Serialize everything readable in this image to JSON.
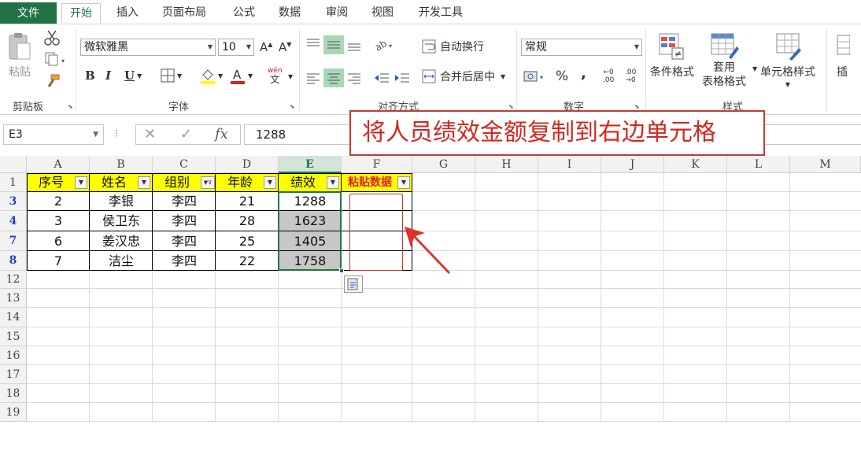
{
  "tabs": [
    "文件",
    "开始",
    "插入",
    "页面布局",
    "公式",
    "数据",
    "审阅",
    "视图",
    "开发工具"
  ],
  "ribbon": {
    "clipboard": {
      "paste_label": "粘贴",
      "group_label": "剪贴板"
    },
    "font": {
      "font_name": "微软雅黑",
      "font_size": "10",
      "group_label": "字体",
      "bold": "B",
      "italic": "I",
      "underline": "U",
      "phonetic_top": "wén",
      "phonetic_bottom": "文"
    },
    "alignment": {
      "wrap_text": "自动换行",
      "merge_center": "合并后居中",
      "group_label": "对齐方式"
    },
    "number": {
      "format": "常规",
      "percent": "%",
      "comma": ",",
      "inc_decimal_top": "←0",
      "inc_decimal_bottom": ".00",
      "dec_decimal_top": ".00",
      "dec_decimal_bottom": "→0",
      "group_label": "数字"
    },
    "styles": {
      "conditional": "条件格式",
      "table_top": "套用",
      "table_bottom": "表格格式",
      "cell_styles": "单元格样式",
      "group_label": "样式"
    },
    "cells": {
      "insert_partial": "插"
    }
  },
  "formula_bar": {
    "name_box": "E3",
    "value": "1288",
    "cancel": "✕",
    "enter": "✓",
    "fx": "fx",
    "sep": "⁝"
  },
  "callout": "将人员绩效金额复制到右边单元格",
  "sheet": {
    "columns": [
      "A",
      "B",
      "C",
      "D",
      "E",
      "F",
      "G",
      "H",
      "I",
      "J",
      "K",
      "L",
      "M"
    ],
    "selected_column": "E",
    "row_numbers": [
      "1",
      "3",
      "4",
      "7",
      "8",
      "12",
      "13",
      "14",
      "15",
      "16",
      "17",
      "18",
      "19"
    ],
    "header_row": [
      "序号",
      "姓名",
      "组别",
      "年龄",
      "绩效",
      "粘贴数据"
    ],
    "data_rows": [
      [
        "2",
        "李银",
        "李四",
        "21",
        "1288",
        ""
      ],
      [
        "3",
        "侯卫东",
        "李四",
        "28",
        "1623",
        ""
      ],
      [
        "6",
        "姜汉忠",
        "李四",
        "25",
        "1405",
        ""
      ],
      [
        "7",
        "洁尘",
        "李四",
        "22",
        "1758",
        ""
      ]
    ],
    "filtered_column": "组别"
  },
  "colors": {
    "accent": "#217346",
    "header_fill": "#ffff00",
    "paste_header_text": "#e02020",
    "callout_red": "#d02a20",
    "copy_gray": "#c7c7c7"
  }
}
